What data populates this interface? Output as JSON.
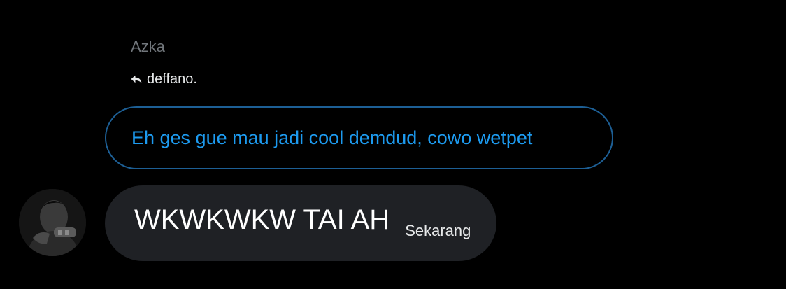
{
  "conversation": {
    "sender_name": "Azka",
    "reply_to": {
      "icon": "reply-arrow-icon",
      "name": "deffano."
    },
    "quoted_message": {
      "text": "Eh ges gue mau jadi cool demdud, cowo wetpet",
      "border_color": "#1d5f95",
      "text_color": "#1d9bf0"
    },
    "message": {
      "text": "WKWKWKW TAI AH",
      "timestamp": "Sekarang",
      "bubble_color": "#1f2125"
    },
    "avatar": {
      "icon": "user-avatar"
    }
  },
  "theme": {
    "background": "#000000",
    "muted_text": "#71767b"
  }
}
